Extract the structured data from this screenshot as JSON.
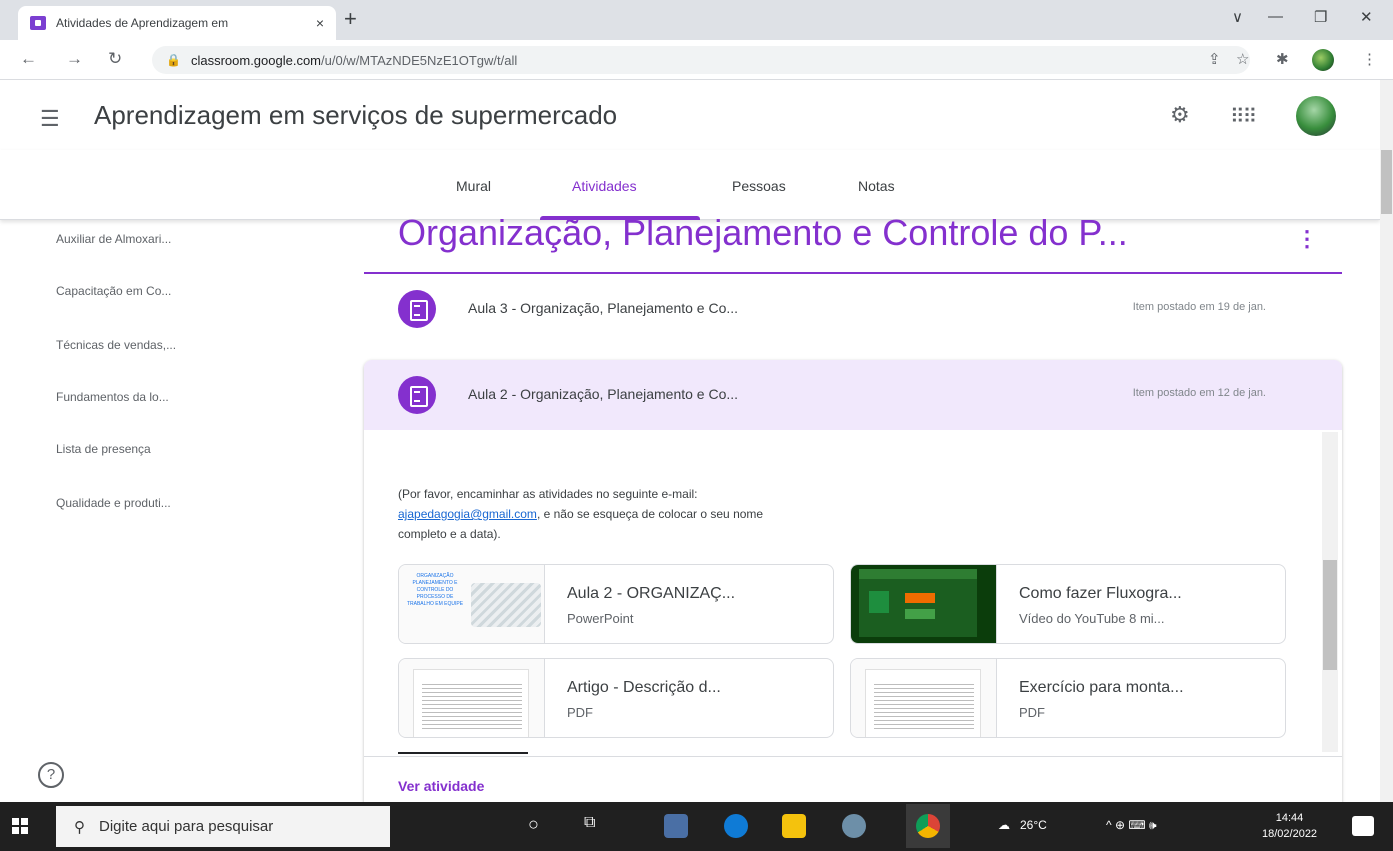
{
  "browser": {
    "tab_title": "Atividades de Aprendizagem em",
    "tab_close": "×",
    "new_tab": "+",
    "url_host": "classroom.google.com",
    "url_path": "/u/0/w/MTAzNDE5NzE1OTgw/t/all",
    "window_controls": [
      "∨",
      "—",
      "❐",
      "✕"
    ]
  },
  "header": {
    "course_title": "Aprendizagem em serviços de supermercado",
    "icons": [
      "menu-icon",
      "settings-icon",
      "apps-icon",
      "account-avatar"
    ]
  },
  "nav_tabs": [
    {
      "label": "Mural",
      "active": false
    },
    {
      "label": "Atividades",
      "active": true
    },
    {
      "label": "Pessoas",
      "active": false
    },
    {
      "label": "Notas",
      "active": false
    }
  ],
  "sidebar": {
    "items": [
      {
        "label": "Auxiliar de Almoxari..."
      },
      {
        "label": "Capacitação em Co..."
      },
      {
        "label": "Técnicas de vendas,..."
      },
      {
        "label": "Fundamentos da lo..."
      },
      {
        "label": "Lista de presença"
      },
      {
        "label": "Qualidade e produti..."
      }
    ]
  },
  "topic": {
    "title": "Organização, Planejamento e Controle do P...",
    "more": "⋮"
  },
  "posts": [
    {
      "title": "Aula 3 - Organização, Planejamento e Co...",
      "date": "Item postado em 19 de jan."
    },
    {
      "title": "Aula 2 - Organização, Planejamento e Co...",
      "date": "Item postado em 12 de jan."
    }
  ],
  "expanded": {
    "desc_line1": "(Por favor, encaminhar as atividades no seguinte e-mail:",
    "email": "ajapedagogia@gmail.com",
    "desc_line2": ", e não se esqueça de colocar o seu nome",
    "desc_line3": "completo e a data).",
    "attachments": [
      {
        "title": "Aula 2 - ORGANIZAÇ...",
        "type": "PowerPoint",
        "thumb_text": "ORGANIZAÇÃO PLANEJAMENTO E CONTROLE DO PROCESSO DE TRABALHO EM EQUIPE"
      },
      {
        "title": "Como fazer Fluxogra...",
        "type": "Vídeo do YouTube  8 mi..."
      },
      {
        "title": "Artigo - Descrição d...",
        "type": "PDF"
      },
      {
        "title": "Exercício para monta...",
        "type": "PDF"
      }
    ],
    "view_link": "Ver atividade"
  },
  "taskbar": {
    "search_placeholder": "Digite aqui para pesquisar",
    "weather": "26°C",
    "tray_icons": "^  ⊕  ⌨  🕪",
    "time": "14:44",
    "date": "18/02/2022",
    "colors": {
      "edge": "#0f7bd6",
      "explorer": "#f4c20d",
      "chrome": "#db4437"
    }
  }
}
